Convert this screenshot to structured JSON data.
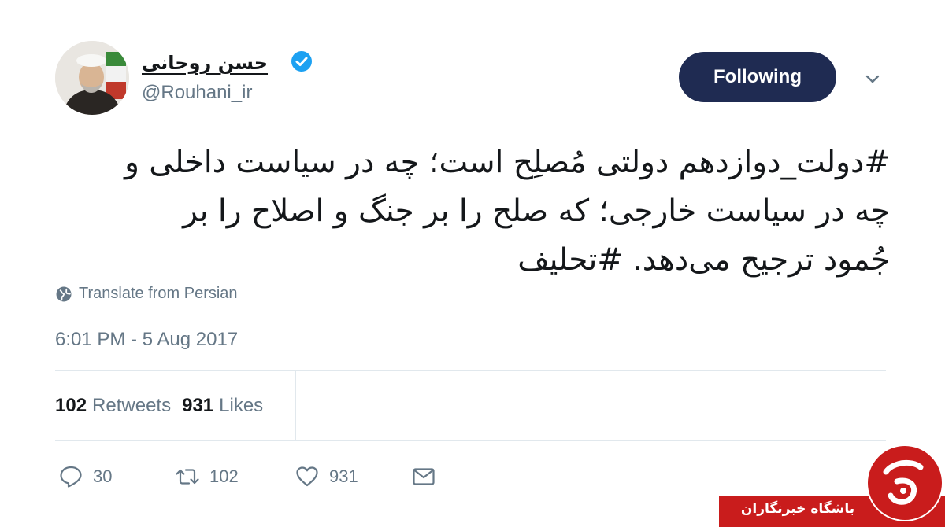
{
  "author": {
    "display_name": "حسن روحانی",
    "handle": "@Rouhani_ir",
    "verified": true
  },
  "follow_button": {
    "label": "Following"
  },
  "tweet": {
    "line1": "#دولت_دوازدهم دولتی مُصلِح است؛ چه در سیاست داخلی و",
    "line2": "چه در سیاست خارجی؛ که صلح را بر جنگ و اصلاح را بر",
    "line3": "جُمود ترجیح می‌دهد. #تحلیف",
    "translate_label": "Translate from Persian",
    "timestamp": "6:01 PM - 5 Aug 2017"
  },
  "stats": {
    "retweets_count": "102",
    "retweets_label": "Retweets",
    "likes_count": "931",
    "likes_label": "Likes"
  },
  "actions": {
    "replies": "30",
    "retweets": "102",
    "likes": "931"
  },
  "watermark": {
    "text": "باشگاه خبرنگاران"
  },
  "colors": {
    "follow_bg": "#1f2b52",
    "verified_blue": "#1da1f2",
    "muted_text": "#657786",
    "watermark_red": "#c91c1c"
  }
}
